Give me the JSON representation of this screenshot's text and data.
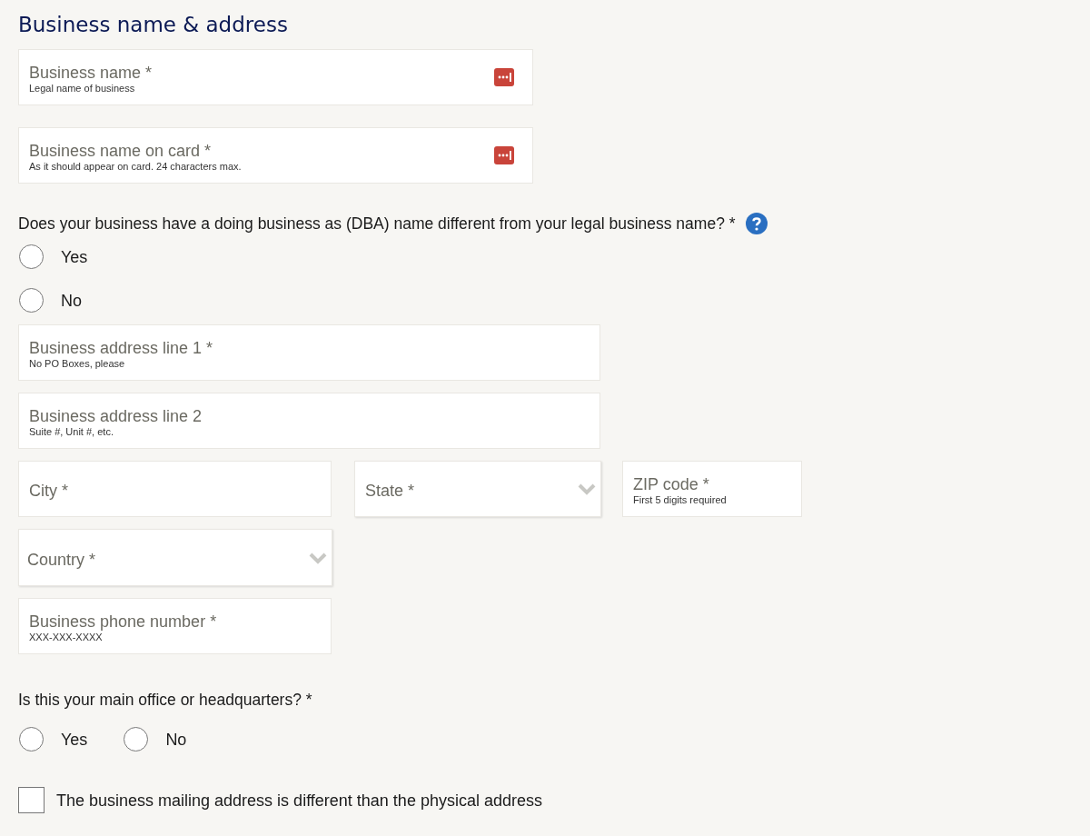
{
  "heading": "Business name & address",
  "name_fields": [
    {
      "kind": "autofill",
      "label": "Business name *",
      "hint": "Legal name of business"
    },
    {
      "kind": "autofill",
      "label": "Business name on card *",
      "hint": "As it should appear on card. 24 characters max."
    }
  ],
  "dba_question": "Does your business have a doing business as (DBA) name different from your legal business name? *",
  "dba_options": [
    {
      "label": "Yes",
      "selected": false
    },
    {
      "label": "No",
      "selected": false
    }
  ],
  "address_rows": [
    [
      {
        "kind": "text",
        "label": "Business address line 1 *",
        "hint": "No PO Boxes, please"
      }
    ],
    [
      {
        "kind": "text",
        "label": "Business address line 2",
        "hint": "Suite #, Unit #, etc."
      }
    ],
    [
      {
        "kind": "text",
        "label": "City *"
      },
      {
        "kind": "select",
        "label": "State *"
      },
      {
        "kind": "text",
        "label": "ZIP code *",
        "hint": "First 5 digits required"
      }
    ],
    [
      {
        "kind": "select",
        "label": "Country *"
      }
    ],
    [
      {
        "kind": "text",
        "label": "Business phone number *",
        "hint": "XXX-XXX-XXXX"
      }
    ]
  ],
  "hq_question": "Is this your main office or headquarters? *",
  "hq_options": [
    {
      "label": "Yes",
      "selected": false
    },
    {
      "label": "No",
      "selected": false
    }
  ],
  "mailing_checkbox": {
    "label": "The business mailing address is different than the physical address",
    "checked": false
  }
}
